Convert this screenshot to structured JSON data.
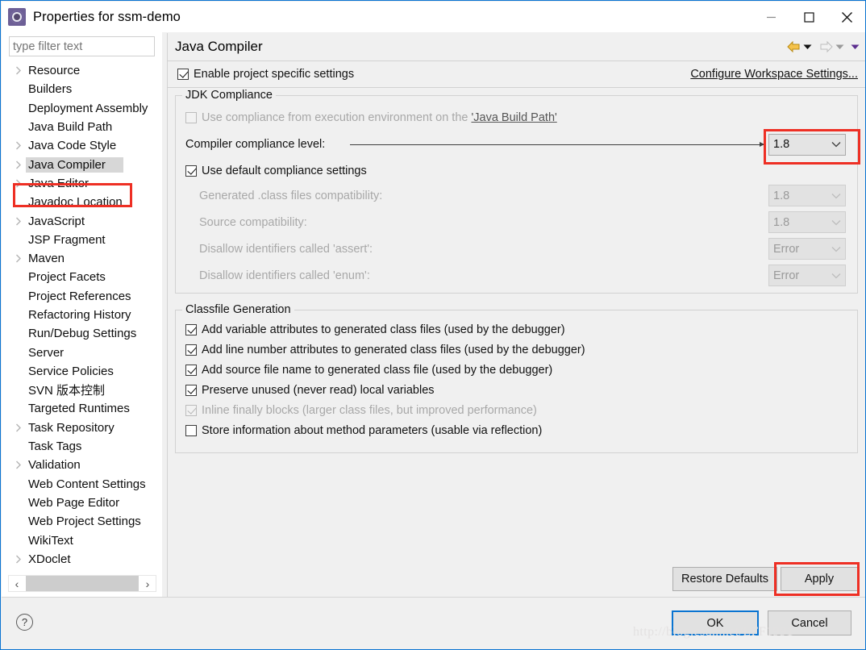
{
  "window": {
    "title": "Properties for ssm-demo",
    "icon": "gear-icon",
    "minimize": "—",
    "maximize": "□",
    "close": "✕"
  },
  "sidebar": {
    "filter_placeholder": "type filter text",
    "filter_value": "",
    "items": [
      {
        "label": "Resource",
        "expandable": true,
        "selected": false
      },
      {
        "label": "Builders",
        "expandable": false,
        "selected": false
      },
      {
        "label": "Deployment Assembly",
        "expandable": false,
        "selected": false
      },
      {
        "label": "Java Build Path",
        "expandable": false,
        "selected": false
      },
      {
        "label": "Java Code Style",
        "expandable": true,
        "selected": false
      },
      {
        "label": "Java Compiler",
        "expandable": true,
        "selected": true
      },
      {
        "label": "Java Editor",
        "expandable": true,
        "selected": false
      },
      {
        "label": "Javadoc Location",
        "expandable": false,
        "selected": false
      },
      {
        "label": "JavaScript",
        "expandable": true,
        "selected": false
      },
      {
        "label": "JSP Fragment",
        "expandable": false,
        "selected": false
      },
      {
        "label": "Maven",
        "expandable": true,
        "selected": false
      },
      {
        "label": "Project Facets",
        "expandable": false,
        "selected": false
      },
      {
        "label": "Project References",
        "expandable": false,
        "selected": false
      },
      {
        "label": "Refactoring History",
        "expandable": false,
        "selected": false
      },
      {
        "label": "Run/Debug Settings",
        "expandable": false,
        "selected": false
      },
      {
        "label": "Server",
        "expandable": false,
        "selected": false
      },
      {
        "label": "Service Policies",
        "expandable": false,
        "selected": false
      },
      {
        "label": "SVN 版本控制",
        "expandable": false,
        "selected": false
      },
      {
        "label": "Targeted Runtimes",
        "expandable": false,
        "selected": false
      },
      {
        "label": "Task Repository",
        "expandable": true,
        "selected": false
      },
      {
        "label": "Task Tags",
        "expandable": false,
        "selected": false
      },
      {
        "label": "Validation",
        "expandable": true,
        "selected": false
      },
      {
        "label": "Web Content Settings",
        "expandable": false,
        "selected": false
      },
      {
        "label": "Web Page Editor",
        "expandable": false,
        "selected": false
      },
      {
        "label": "Web Project Settings",
        "expandable": false,
        "selected": false
      },
      {
        "label": "WikiText",
        "expandable": false,
        "selected": false
      },
      {
        "label": "XDoclet",
        "expandable": true,
        "selected": false
      }
    ],
    "scroll_left": "‹",
    "scroll_right": "›"
  },
  "page": {
    "title": "Java Compiler",
    "enable_project_specific": {
      "label": "Enable project specific settings",
      "checked": true
    },
    "configure_workspace_link": "Configure Workspace Settings...",
    "jdk_compliance": {
      "group_title": "JDK Compliance",
      "use_execution_env": {
        "label_before": "Use compliance from execution environment on the ",
        "link": "'Java Build Path'",
        "checked": false,
        "enabled": false
      },
      "compliance_level": {
        "label": "Compiler compliance level:",
        "value": "1.8",
        "enabled": true,
        "highlighted": true
      },
      "use_default_settings": {
        "label": "Use default compliance settings",
        "checked": true
      },
      "rows": [
        {
          "label": "Generated .class files compatibility:",
          "value": "1.8",
          "enabled": false
        },
        {
          "label": "Source compatibility:",
          "value": "1.8",
          "enabled": false
        },
        {
          "label": "Disallow identifiers called 'assert':",
          "value": "Error",
          "enabled": false
        },
        {
          "label": "Disallow identifiers called 'enum':",
          "value": "Error",
          "enabled": false
        }
      ]
    },
    "classfile_generation": {
      "group_title": "Classfile Generation",
      "options": [
        {
          "label": "Add variable attributes to generated class files (used by the debugger)",
          "checked": true,
          "enabled": true
        },
        {
          "label": "Add line number attributes to generated class files (used by the debugger)",
          "checked": true,
          "enabled": true
        },
        {
          "label": "Add source file name to generated class file (used by the debugger)",
          "checked": true,
          "enabled": true
        },
        {
          "label": "Preserve unused (never read) local variables",
          "checked": true,
          "enabled": true
        },
        {
          "label": "Inline finally blocks (larger class files, but improved performance)",
          "checked": true,
          "enabled": false
        },
        {
          "label": "Store information about method parameters (usable via reflection)",
          "checked": false,
          "enabled": true
        }
      ]
    },
    "restore_defaults_label": "Restore Defaults",
    "apply_label": "Apply"
  },
  "footer": {
    "help_glyph": "?",
    "ok_label": "OK",
    "cancel_label": "Cancel"
  },
  "watermark": "http://blog.csdn.net/LFF1991",
  "colors": {
    "accent": "#0a74d1",
    "highlight_red": "#ee2f24",
    "selection_gray": "#d7d7d7",
    "panel_bg": "#f0f0f0"
  }
}
